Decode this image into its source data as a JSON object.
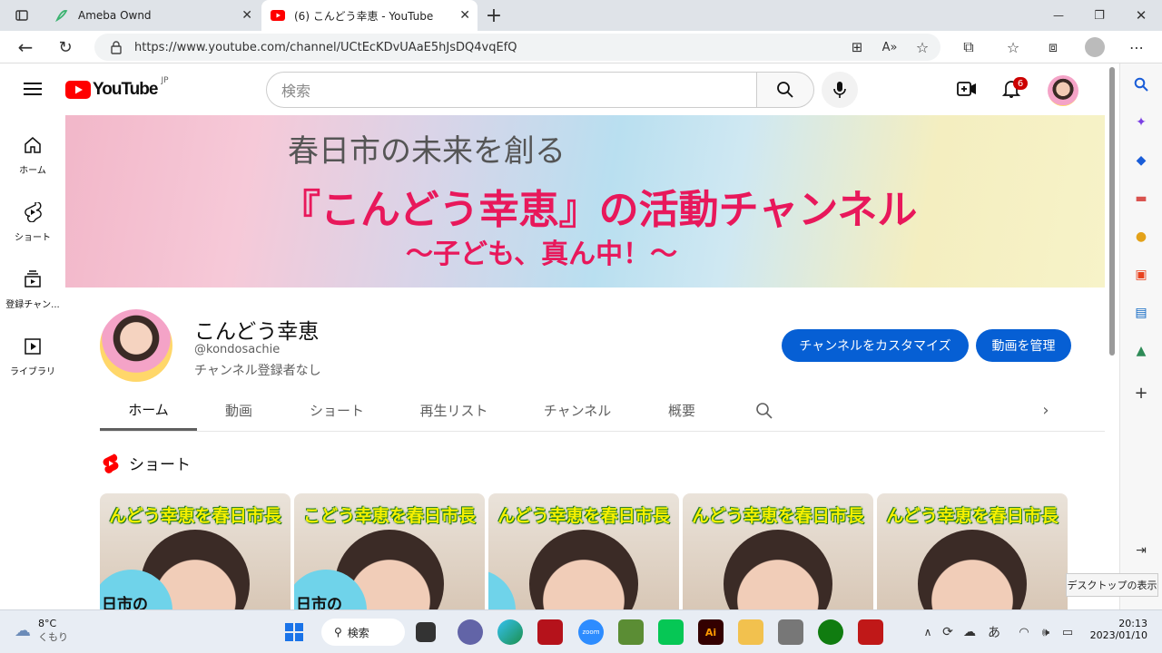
{
  "browser": {
    "tabs": [
      {
        "title": "Ameba Ownd"
      },
      {
        "title": "(6) こんどう幸恵 - YouTube"
      }
    ],
    "new_tab": "+",
    "url": "https://www.youtube.com/channel/UCtEcKDvUAaE5hJsDQ4vqEfQ",
    "window_controls": {
      "minimize": "—",
      "restore": "❐",
      "close": "✕"
    }
  },
  "youtube": {
    "logo_text": "YouTube",
    "logo_region": "JP",
    "search_placeholder": "検索",
    "notification_count": "6",
    "nav": [
      {
        "label": "ホーム",
        "icon": "home-icon"
      },
      {
        "label": "ショート",
        "icon": "shorts-icon"
      },
      {
        "label": "登録チャン...",
        "icon": "subscriptions-icon"
      },
      {
        "label": "ライブラリ",
        "icon": "library-icon"
      }
    ],
    "banner": {
      "line1": "春日市の未来を創る",
      "line2": "『こんどう幸恵』の活動チャンネル",
      "line3": "～子ども、真ん中！～"
    },
    "channel": {
      "name": "こんどう幸恵",
      "handle": "@kondosachie",
      "subscribers": "チャンネル登録者なし",
      "customize_button": "チャンネルをカスタマイズ",
      "manage_button": "動画を管理"
    },
    "tabs": [
      "ホーム",
      "動画",
      "ショート",
      "再生リスト",
      "チャンネル",
      "概要"
    ],
    "shorts_section_title": "ショート",
    "shorts": [
      {
        "caption": "んどう幸恵を春日市長",
        "overlay": "日市の"
      },
      {
        "caption": "こどう幸恵を春日市長",
        "overlay": "日市の"
      },
      {
        "caption": "んどう幸恵を春日市長",
        "overlay": ""
      },
      {
        "caption": "んどう幸恵を春日市長",
        "overlay": ""
      },
      {
        "caption": "んどう幸恵を春日市長",
        "overlay": ""
      }
    ]
  },
  "tooltip": "デスクトップの表示",
  "taskbar": {
    "weather_temp": "8°C",
    "weather_desc": "くもり",
    "search_label": "検索",
    "time": "20:13",
    "date": "2023/01/10",
    "ime": "あ"
  },
  "colors": {
    "accent_blue": "#065fd4",
    "youtube_red": "#ff0000",
    "banner_pink": "#e8185b"
  }
}
